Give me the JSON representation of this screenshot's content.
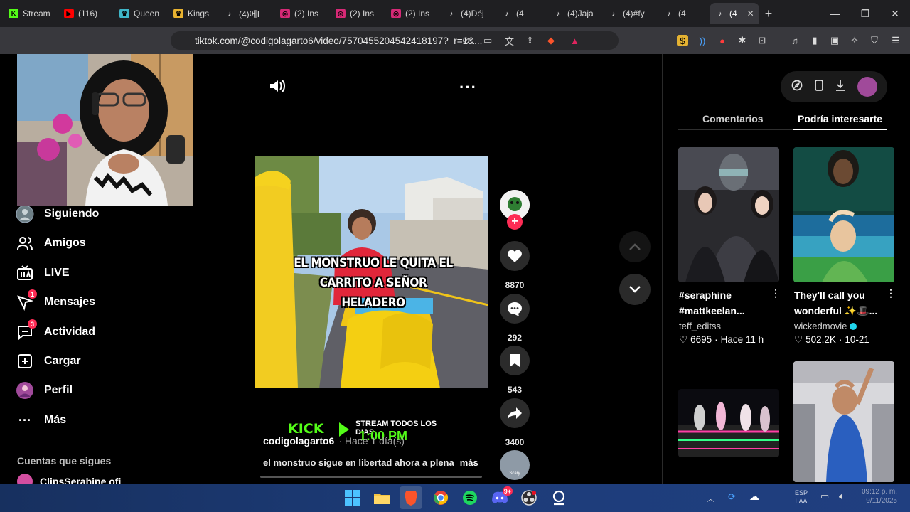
{
  "browser": {
    "tabs": [
      {
        "label": "Stream",
        "icon": "kick-icon",
        "color": "#53fc18"
      },
      {
        "label": "(116) ",
        "icon": "youtube-icon",
        "color": "#ff0000"
      },
      {
        "label": "Queen",
        "icon": "crown-icon",
        "color": "#3fb6c8"
      },
      {
        "label": "Kings",
        "icon": "crown-icon",
        "color": "#e8b230"
      },
      {
        "label": "(4)에I",
        "icon": "tiktok-icon",
        "color": "#ffffff"
      },
      {
        "label": "(2) Ins",
        "icon": "instagram-icon",
        "color": "#d62976"
      },
      {
        "label": "(2) Ins",
        "icon": "instagram-icon",
        "color": "#d62976"
      },
      {
        "label": "(2) Ins",
        "icon": "instagram-icon",
        "color": "#d62976"
      },
      {
        "label": "(4)Déj",
        "icon": "tiktok-icon",
        "color": "#ffffff"
      },
      {
        "label": "(4",
        "icon": "tiktok-icon",
        "color": "#ffffff"
      },
      {
        "label": "(4)Jaja",
        "icon": "tiktok-icon",
        "color": "#ffffff"
      },
      {
        "label": "(4)#fy",
        "icon": "tiktok-icon",
        "color": "#ffffff"
      },
      {
        "label": "(4",
        "icon": "tiktok-icon",
        "color": "#ffffff"
      },
      {
        "label": "(4",
        "icon": "tiktok-icon",
        "color": "#ffffff",
        "active": true
      }
    ],
    "url": "tiktok.com/@codigolagarto6/video/7570455204542418197?_r=1&..."
  },
  "sidebar": {
    "items": [
      {
        "label": "Siguiendo",
        "icon": "following-avatar-icon"
      },
      {
        "label": "Amigos",
        "icon": "friends-icon"
      },
      {
        "label": "LIVE",
        "icon": "live-icon"
      },
      {
        "label": "Mensajes",
        "icon": "messages-icon",
        "badge": "1"
      },
      {
        "label": "Actividad",
        "icon": "activity-icon",
        "badge": "3"
      },
      {
        "label": "Cargar",
        "icon": "upload-icon"
      },
      {
        "label": "Perfil",
        "icon": "profile-avatar-icon"
      },
      {
        "label": "Más",
        "icon": "more-icon"
      }
    ],
    "following_header": "Cuentas que sigues",
    "following_first": "ClipsSerahine ofi"
  },
  "video": {
    "caption_overlay": "EL MONSTRUO LE QUITA EL CARRITO A SEÑOR HELADERO",
    "author": "codigolagarto6",
    "time_ago": "· Hace 1 día(s)",
    "description": "el monstruo sigue en libertad ahora a plena",
    "more_label": "más",
    "stream_banner": {
      "brand": "KICK",
      "line1": "STREAM TODOS LOS DIAS",
      "line2": "1:00 PM"
    },
    "likes": "8870",
    "comments": "292",
    "saves": "543",
    "shares": "3400",
    "music_disc_label": "Scary"
  },
  "right_panel": {
    "tabs": [
      "Comentarios",
      "Podría interesarte"
    ],
    "active_tab": "Podría interesarte",
    "cards": [
      {
        "title": "#seraphine #mattkeelan...",
        "author": "teff_editss",
        "likes": "6695",
        "date": "Hace 11 h",
        "verified": false
      },
      {
        "title": "They'll call you wonderful ✨🎩...",
        "author": "wickedmovie",
        "likes": "502.2K",
        "date": "10-21",
        "verified": true
      }
    ]
  },
  "taskbar": {
    "lang": "ESP",
    "lang_sub": "LAA",
    "time": "09:12 p. m.",
    "date": "9/11/2025",
    "discord_badge": "9+"
  },
  "colors": {
    "accent": "#fe2c55",
    "kick_green": "#53fc18",
    "card_underline": "#ffffff"
  }
}
